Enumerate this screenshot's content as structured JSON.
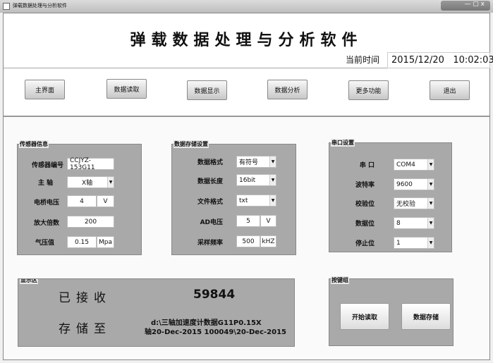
{
  "window": {
    "title": "弹载数据处理与分析软件",
    "controls": "— ▢ x"
  },
  "header": {
    "title": "弹载数据处理与分析软件",
    "time_label": "当前时间",
    "time_value": "2015/12/20   10:02:03"
  },
  "nav": [
    "主界面",
    "数据读取",
    "数据显示",
    "数据分析",
    "更多功能",
    "退出"
  ],
  "sensor": {
    "title": "传感器信息",
    "id_label": "传感器编号",
    "id_value": "CCJYZ-153G11",
    "axis_label": "主 轴",
    "axis_value": "X轴",
    "bridge_label": "电桥电压",
    "bridge_value": "4",
    "bridge_unit": "V",
    "gain_label": "放大倍数",
    "gain_value": "200",
    "pressure_label": "气压值",
    "pressure_value": "0.15",
    "pressure_unit": "Mpa"
  },
  "storage": {
    "title": "数据存储设置",
    "format_label": "数据格式",
    "format_value": "有符号",
    "length_label": "数据长度",
    "length_value": "16bit",
    "file_label": "文件格式",
    "file_value": "txt",
    "ad_label": "AD电压",
    "ad_value": "5",
    "ad_unit": "V",
    "rate_label": "采样频率",
    "rate_value": "500",
    "rate_unit": "kHZ"
  },
  "serial": {
    "title": "串口设置",
    "port_label": "串 口",
    "port_value": "COM4",
    "baud_label": "波特率",
    "baud_value": "9600",
    "parity_label": "校验位",
    "parity_value": "无校验",
    "databits_label": "数据位",
    "databits_value": "8",
    "stop_label": "停止位",
    "stop_value": "1"
  },
  "display": {
    "title": "显示区",
    "received_label": "已接收",
    "received_value": "59844",
    "saved_label": "存储至",
    "path_line1": "d:\\三轴加速度计数据G11P0.15X",
    "path_line2": "轴20-Dec-2015 100049\\20-Dec-2015"
  },
  "buttons": {
    "title": "按键组",
    "start": "开始读取",
    "save": "数据存储"
  },
  "icons": {
    "arrow": "▼"
  }
}
